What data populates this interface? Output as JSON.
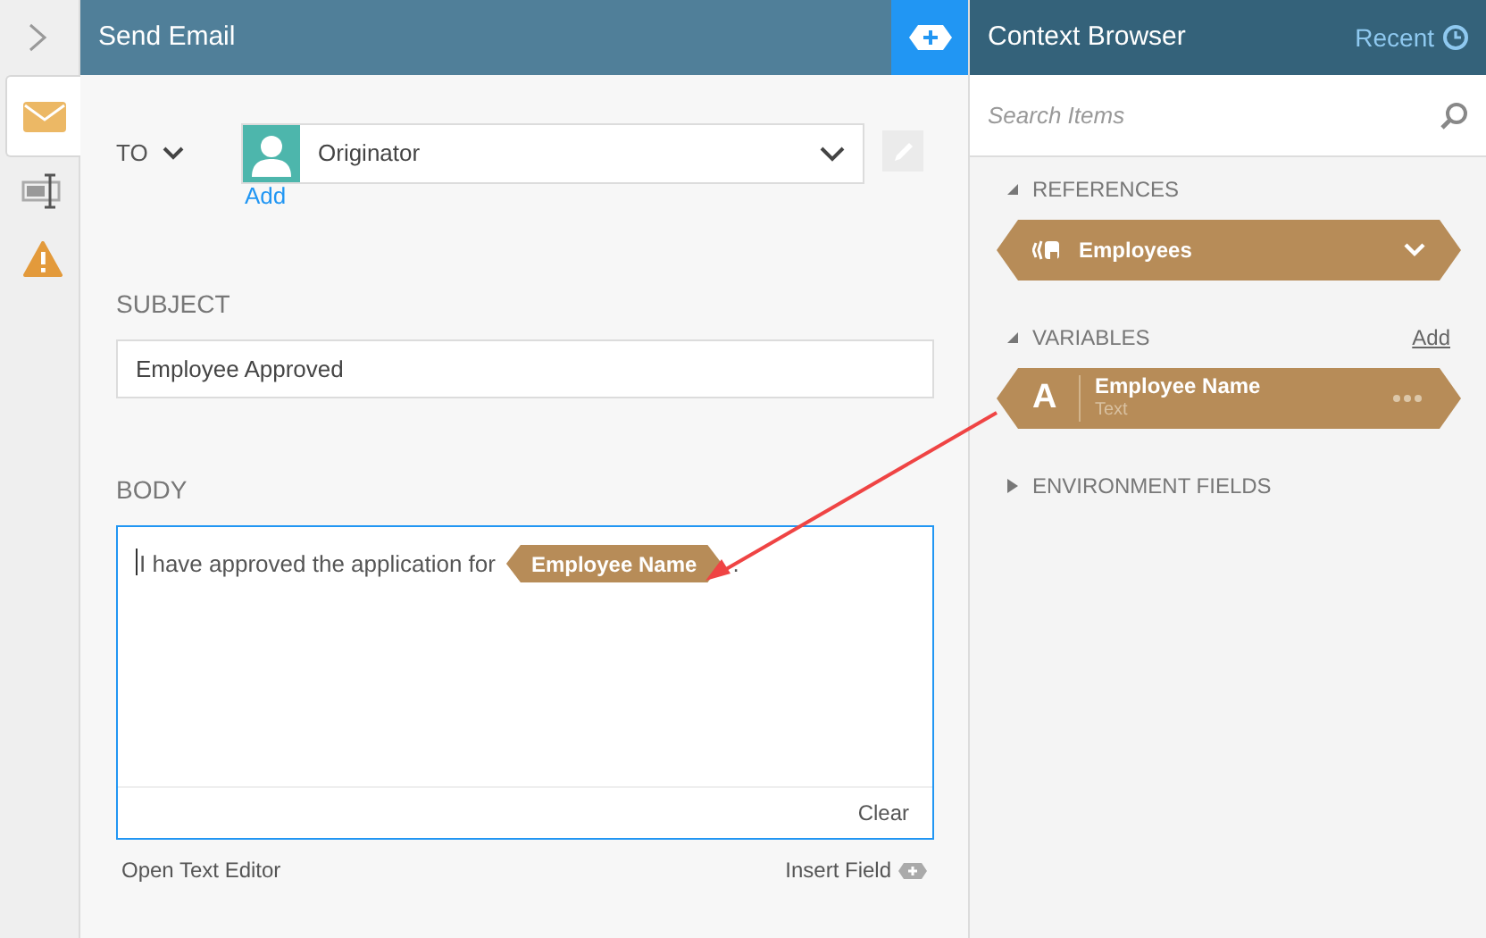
{
  "side_tabs": [
    {
      "kind": "email",
      "selected": true
    },
    {
      "kind": "form",
      "selected": false
    },
    {
      "kind": "warning",
      "selected": false
    }
  ],
  "panel": {
    "title": "Send Email",
    "to": {
      "label": "TO",
      "value": "Originator",
      "add": "Add"
    },
    "subject": {
      "label": "SUBJECT",
      "value": "Employee Approved"
    },
    "body": {
      "label": "BODY",
      "content": [
        {
          "kind": "text",
          "text": "I have approved the application for"
        },
        {
          "kind": "field",
          "text": "Employee Name"
        },
        {
          "kind": "text",
          "text": "."
        }
      ],
      "clear": "Clear"
    },
    "open_editor": "Open Text Editor",
    "insert_field": "Insert Field"
  },
  "context_browser": {
    "title": "Context Browser",
    "recent": "Recent",
    "search": {
      "placeholder": "Search Items"
    },
    "sections": [
      {
        "title": "REFERENCES",
        "expanded": true,
        "items": [
          {
            "kind": "reference",
            "name": "Employees"
          }
        ]
      },
      {
        "title": "VARIABLES",
        "expanded": true,
        "add": "Add",
        "items": [
          {
            "kind": "variable",
            "name": "Employee Name",
            "type_letter": "A",
            "type": "Text"
          }
        ]
      },
      {
        "title": "ENVIRONMENT FIELDS",
        "expanded": false
      }
    ]
  }
}
